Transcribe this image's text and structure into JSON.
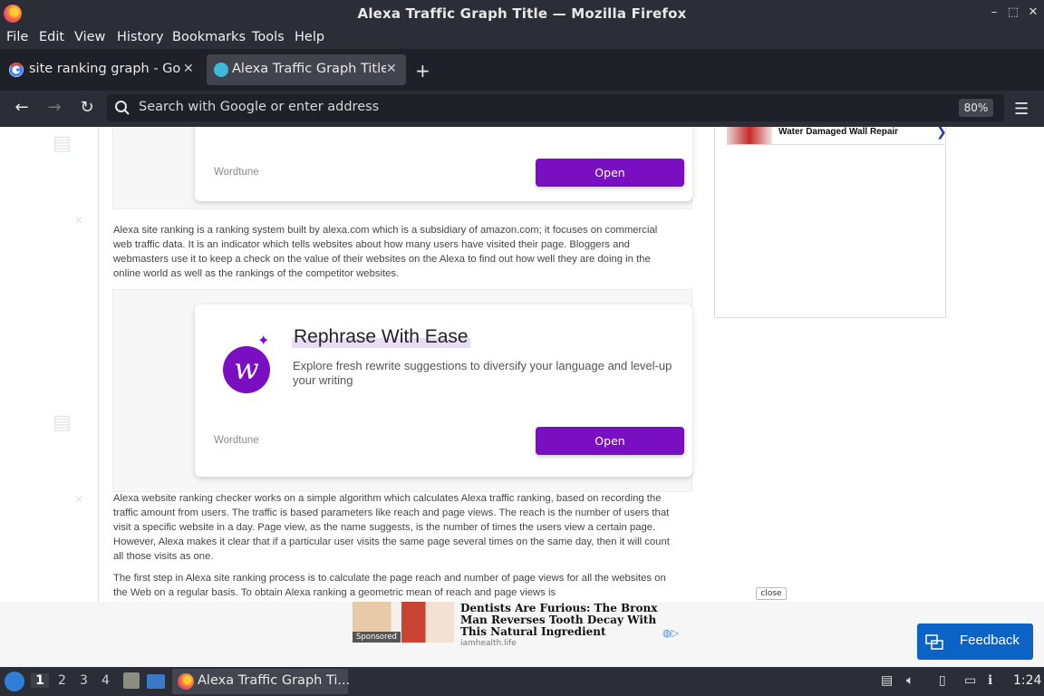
{
  "window": {
    "title": "Alexa Traffic Graph Title — Mozilla Firefox",
    "controls": {
      "minimize": "–",
      "restore": "⬚",
      "close": "✕"
    }
  },
  "menu": [
    "File",
    "Edit",
    "View",
    "History",
    "Bookmarks",
    "Tools",
    "Help"
  ],
  "tabs": [
    {
      "label": "site ranking graph - Goo",
      "favicon": "google-icon",
      "active": false
    },
    {
      "label": "Alexa Traffic Graph Title",
      "favicon": "site-icon",
      "active": true
    }
  ],
  "nav": {
    "placeholder": "Search with Google or enter address",
    "zoom": "80%"
  },
  "content": {
    "ad1": {
      "brand": "Wordtune",
      "button": "Open"
    },
    "paragraph1": "Alexa site ranking is a ranking system built by alexa.com which is a subsidiary of amazon.com; it focuses on commercial web traffic data. It is an indicator which tells websites about how many users have visited their page. Bloggers and webmasters use it to keep a check on the value of their websites on the Alexa to find out how well they are doing in the online world as well as the rankings of the competitor websites.",
    "ad2": {
      "headline": "Rephrase With Ease",
      "subtext": "Explore fresh rewrite suggestions to diversify your language and level-up your writing",
      "brand": "Wordtune",
      "button": "Open"
    },
    "paragraph2": "Alexa website ranking checker works on a simple algorithm which calculates Alexa traffic ranking, based on recording the traffic amount from users. The traffic is based parameters like reach and page views. The reach is the number of users that visit a specific website in a day. Page view, as the name suggests, is the number of times the users view a certain page. However, Alexa makes it clear that if a particular user visits the same page several times on the same day, then it will count all those visits as one.",
    "paragraph3": "The first step in Alexa site ranking process is to calculate the page reach and number of page views for all the websites on the Web on a regular basis. To obtain Alexa ranking a geometric mean of reach and page views is",
    "side_ad": {
      "text": "Water Damaged Wall Repair",
      "arrow": "❯"
    }
  },
  "bottom_ad": {
    "close": "close",
    "sponsored": "Sponsored",
    "headline": "Dentists Are Furious: The Bronx Man Reverses Tooth Decay With This Natural Ingredient",
    "source": "iamhealth.life"
  },
  "feedback": {
    "label": "Feedback"
  },
  "taskbar": {
    "workspaces": [
      "1",
      "2",
      "3",
      "4"
    ],
    "app_label": "Alexa Traffic Graph Ti...",
    "clock": "1:24"
  }
}
